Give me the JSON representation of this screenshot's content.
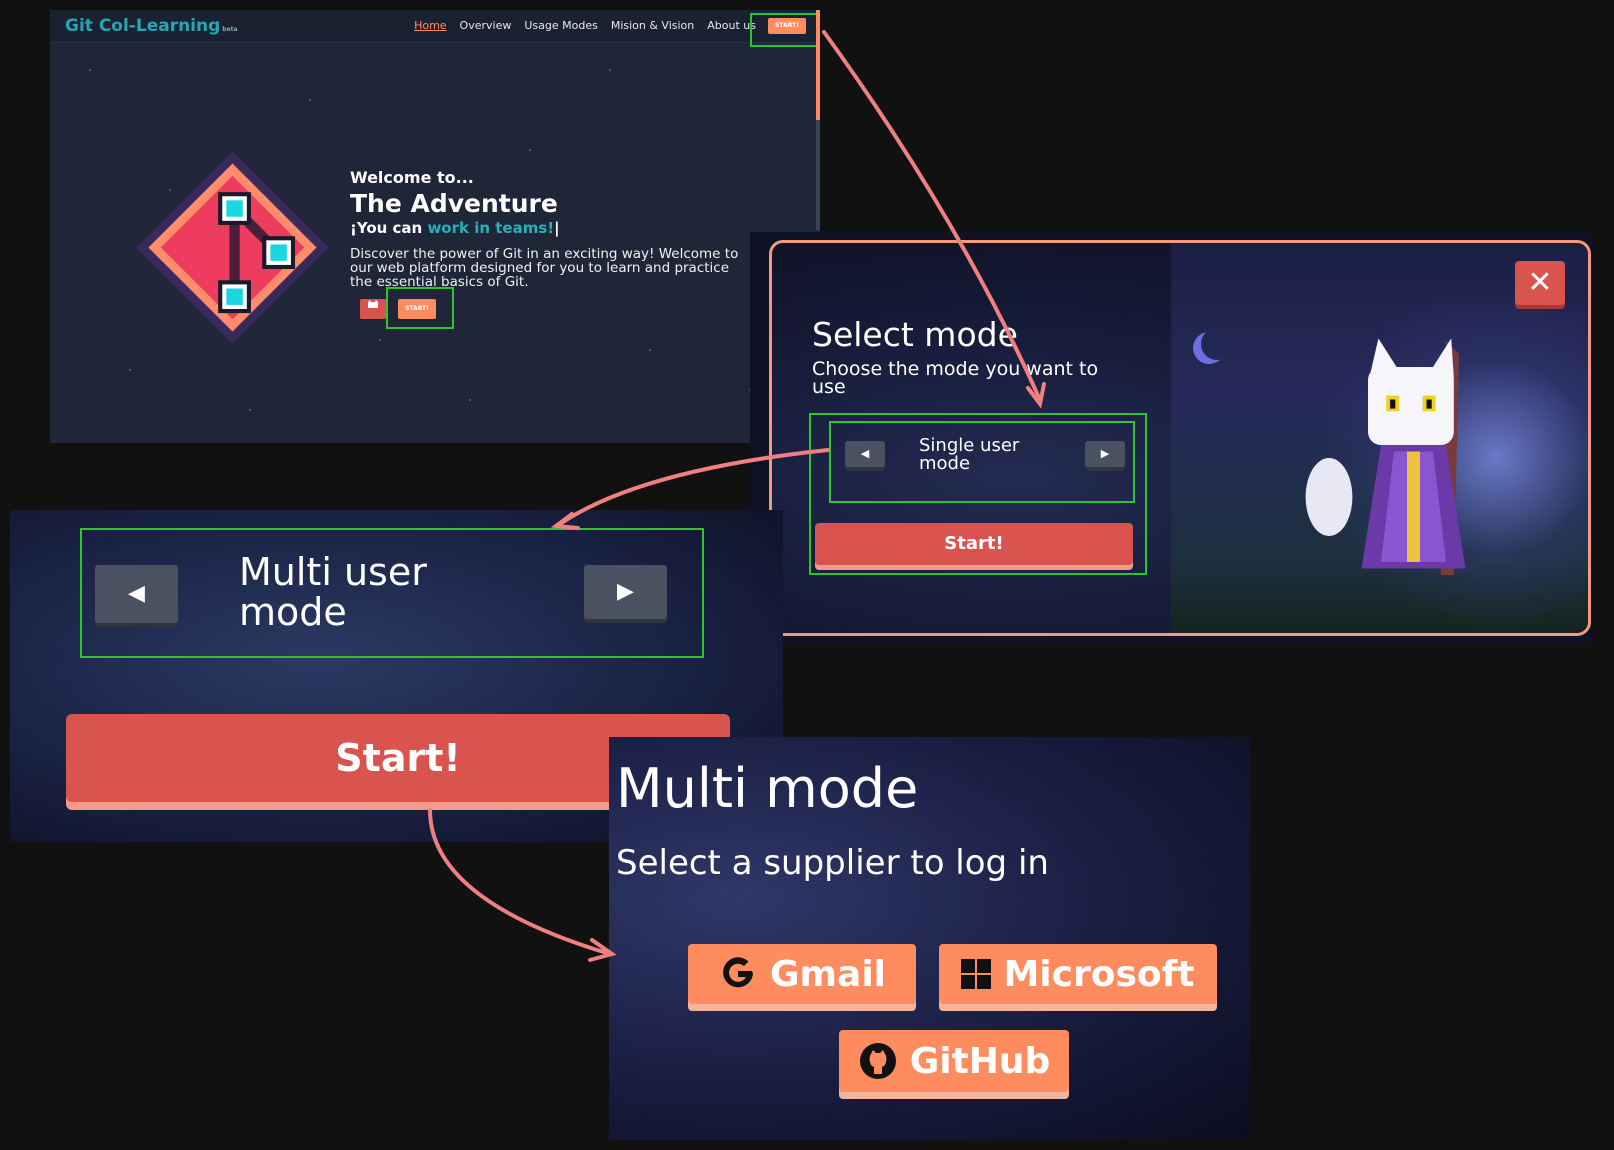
{
  "landing": {
    "brand": "Git Col-Learning",
    "brand_small": "beta",
    "nav": [
      "Home",
      "Overview",
      "Usage Modes",
      "Mision & Vision",
      "About us"
    ],
    "nav_start": "START!",
    "welcome": "Welcome to...",
    "title": "The Adventure",
    "tag_prefix": "¡You can ",
    "tag_highlight": "work in teams!",
    "tag_cursor": "|",
    "description": "Discover the power of Git in an exciting way! Welcome to our web platform designed for you to learn and practice the essential basics of Git.",
    "hero_start": "START!"
  },
  "modal": {
    "title": "Select mode",
    "subtitle": "Choose the mode you want to use",
    "mode": "Single user mode",
    "start": "Start!",
    "close": "✕"
  },
  "multi_zoom": {
    "mode": "Multi user mode",
    "start": "Start!"
  },
  "login": {
    "title": "Multi mode",
    "subtitle": "Select a supplier to log in",
    "providers": [
      "Gmail",
      "Microsoft",
      "GitHub"
    ]
  },
  "colors": {
    "accent_orange": "#ff8c5e",
    "accent_red": "#d9534f",
    "teal": "#23a8b3",
    "highlight_green": "#2ec42e",
    "arrow_pink": "#f07f80"
  },
  "icons": [
    "git-logo-icon",
    "cat-icon",
    "close-icon",
    "chevron-left-icon",
    "chevron-right-icon",
    "google-icon",
    "windows-icon",
    "github-icon"
  ]
}
